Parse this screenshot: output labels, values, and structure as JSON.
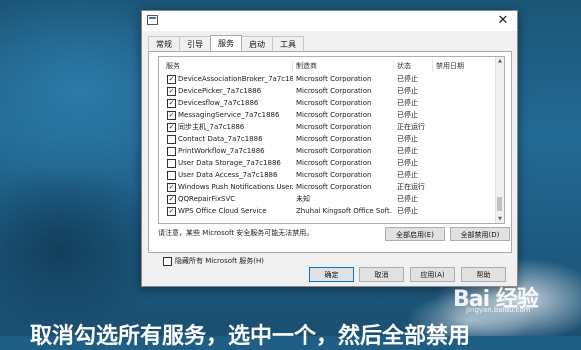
{
  "window": {
    "close_glyph": "✕"
  },
  "tabs": [
    "常规",
    "引导",
    "服务",
    "启动",
    "工具"
  ],
  "active_tab": "服务",
  "list": {
    "headers": {
      "service": "服务",
      "maker": "制造商",
      "status": "状态",
      "disabled_date": "禁用日期"
    },
    "rows": [
      {
        "checked": true,
        "name": "DeviceAssociationBroker_7a7c18...",
        "maker": "Microsoft Corporation",
        "status": "已停止"
      },
      {
        "checked": true,
        "name": "DevicePicker_7a7c1886",
        "maker": "Microsoft Corporation",
        "status": "已停止"
      },
      {
        "checked": true,
        "name": "Devicesflow_7a7c1886",
        "maker": "Microsoft Corporation",
        "status": "已停止"
      },
      {
        "checked": true,
        "name": "MessagingService_7a7c1886",
        "maker": "Microsoft Corporation",
        "status": "已停止"
      },
      {
        "checked": true,
        "name": "同步主机_7a7c1886",
        "maker": "Microsoft Corporation",
        "status": "正在运行"
      },
      {
        "checked": false,
        "name": "Contact Data_7a7c1886",
        "maker": "Microsoft Corporation",
        "status": "已停止"
      },
      {
        "checked": false,
        "name": "PrintWorkflow_7a7c1886",
        "maker": "Microsoft Corporation",
        "status": "已停止"
      },
      {
        "checked": false,
        "name": "User Data Storage_7a7c1886",
        "maker": "Microsoft Corporation",
        "status": "已停止"
      },
      {
        "checked": false,
        "name": "User Data Access_7a7c1886",
        "maker": "Microsoft Corporation",
        "status": "已停止"
      },
      {
        "checked": true,
        "name": "Windows Push Notifications User...",
        "maker": "Microsoft Corporation",
        "status": "正在运行"
      },
      {
        "checked": true,
        "name": "QQRepairFixSVC",
        "maker": "未知",
        "status": "已停止"
      },
      {
        "checked": true,
        "name": "WPS Office Cloud Service",
        "maker": "Zhuhai Kingsoft Office Soft...",
        "status": "已停止"
      }
    ]
  },
  "note": "请注意，某些 Microsoft 安全服务可能无法禁用。",
  "buttons": {
    "enable_all": "全部启用(E)",
    "disable_all": "全部禁用(D)",
    "hide_ms": "隐藏所有 Microsoft 服务(H)",
    "ok": "确定",
    "cancel": "取消",
    "apply": "应用(A)",
    "help": "帮助"
  },
  "overlay": {
    "watermark": "Bai 经验",
    "watermark_sub": "jingyan.baidu.com",
    "caption": "取消勾选所有服务，选中一个，然后全部禁用"
  }
}
